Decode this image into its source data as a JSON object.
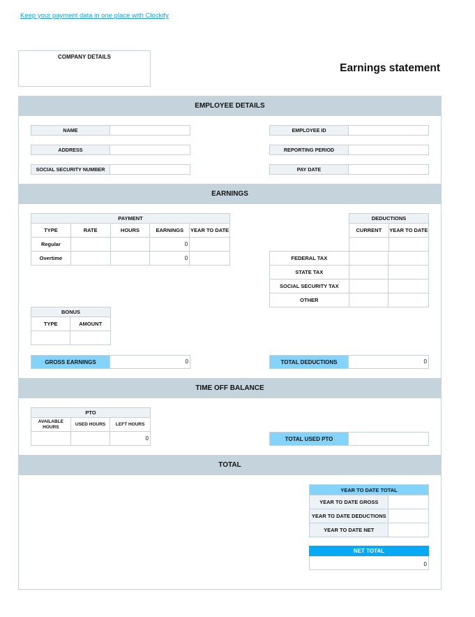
{
  "promo_link": "Keep your payment data in one place with Clockify",
  "company_details_label": "COMPANY DETAILS",
  "title": "Earnings statement",
  "sections": {
    "employee_details": "EMPLOYEE DETAILS",
    "earnings": "EARNINGS",
    "time_off_balance": "TIME OFF BALANCE",
    "total": "TOTAL"
  },
  "employee": {
    "left": [
      {
        "label": "NAME",
        "value": ""
      },
      {
        "label": "ADDRESS",
        "value": ""
      },
      {
        "label": "SOCIAL SECURITY NUMBER",
        "value": ""
      }
    ],
    "right": [
      {
        "label": "EMPLOYEE ID",
        "value": ""
      },
      {
        "label": "REPORTING PERIOD",
        "value": ""
      },
      {
        "label": "PAY DATE",
        "value": ""
      }
    ]
  },
  "payment": {
    "title": "PAYMENT",
    "columns": [
      "TYPE",
      "RATE",
      "HOURS",
      "EARNINGS",
      "YEAR TO DATE"
    ],
    "rows": [
      {
        "type": "Regular",
        "rate": "",
        "hours": "",
        "earnings": "0",
        "ytd": ""
      },
      {
        "type": "Overtime",
        "rate": "",
        "hours": "",
        "earnings": "0",
        "ytd": ""
      }
    ]
  },
  "deductions": {
    "title": "DEDUCTIONS",
    "columns": [
      "CURRENT",
      "YEAR TO DATE"
    ],
    "rows": [
      "FEDERAL TAX",
      "STATE TAX",
      "SOCIAL SECURITY TAX",
      "OTHER"
    ]
  },
  "bonus": {
    "title": "BONUS",
    "columns": [
      "TYPE",
      "AMOUNT"
    ]
  },
  "gross_earnings": {
    "label": "GROSS EARNINGS",
    "value": "0"
  },
  "total_deductions": {
    "label": "TOTAL DEDUCTIONS",
    "value": "0"
  },
  "pto": {
    "title": "PTO",
    "columns": [
      "AVAILABLE HOURS",
      "USED HOURS",
      "LEFT HOURS"
    ],
    "values": [
      "",
      "",
      "0"
    ]
  },
  "total_used_pto": {
    "label": "TOTAL USED PTO",
    "value": ""
  },
  "ytd_total": {
    "title": "YEAR TO DATE TOTAL",
    "rows": [
      "YEAR TO DATE GROSS",
      "YEAR TO DATE DEDUCTIONS",
      "YEAR TO DATE NET"
    ]
  },
  "net_total": {
    "label": "NET TOTAL",
    "value": "0"
  },
  "colors": {
    "band": "#c5d3dc",
    "header_cell": "#edf2f6",
    "highlight": "#84d3fa",
    "net_total": "#05a9f4",
    "link": "#1a9fe0"
  }
}
